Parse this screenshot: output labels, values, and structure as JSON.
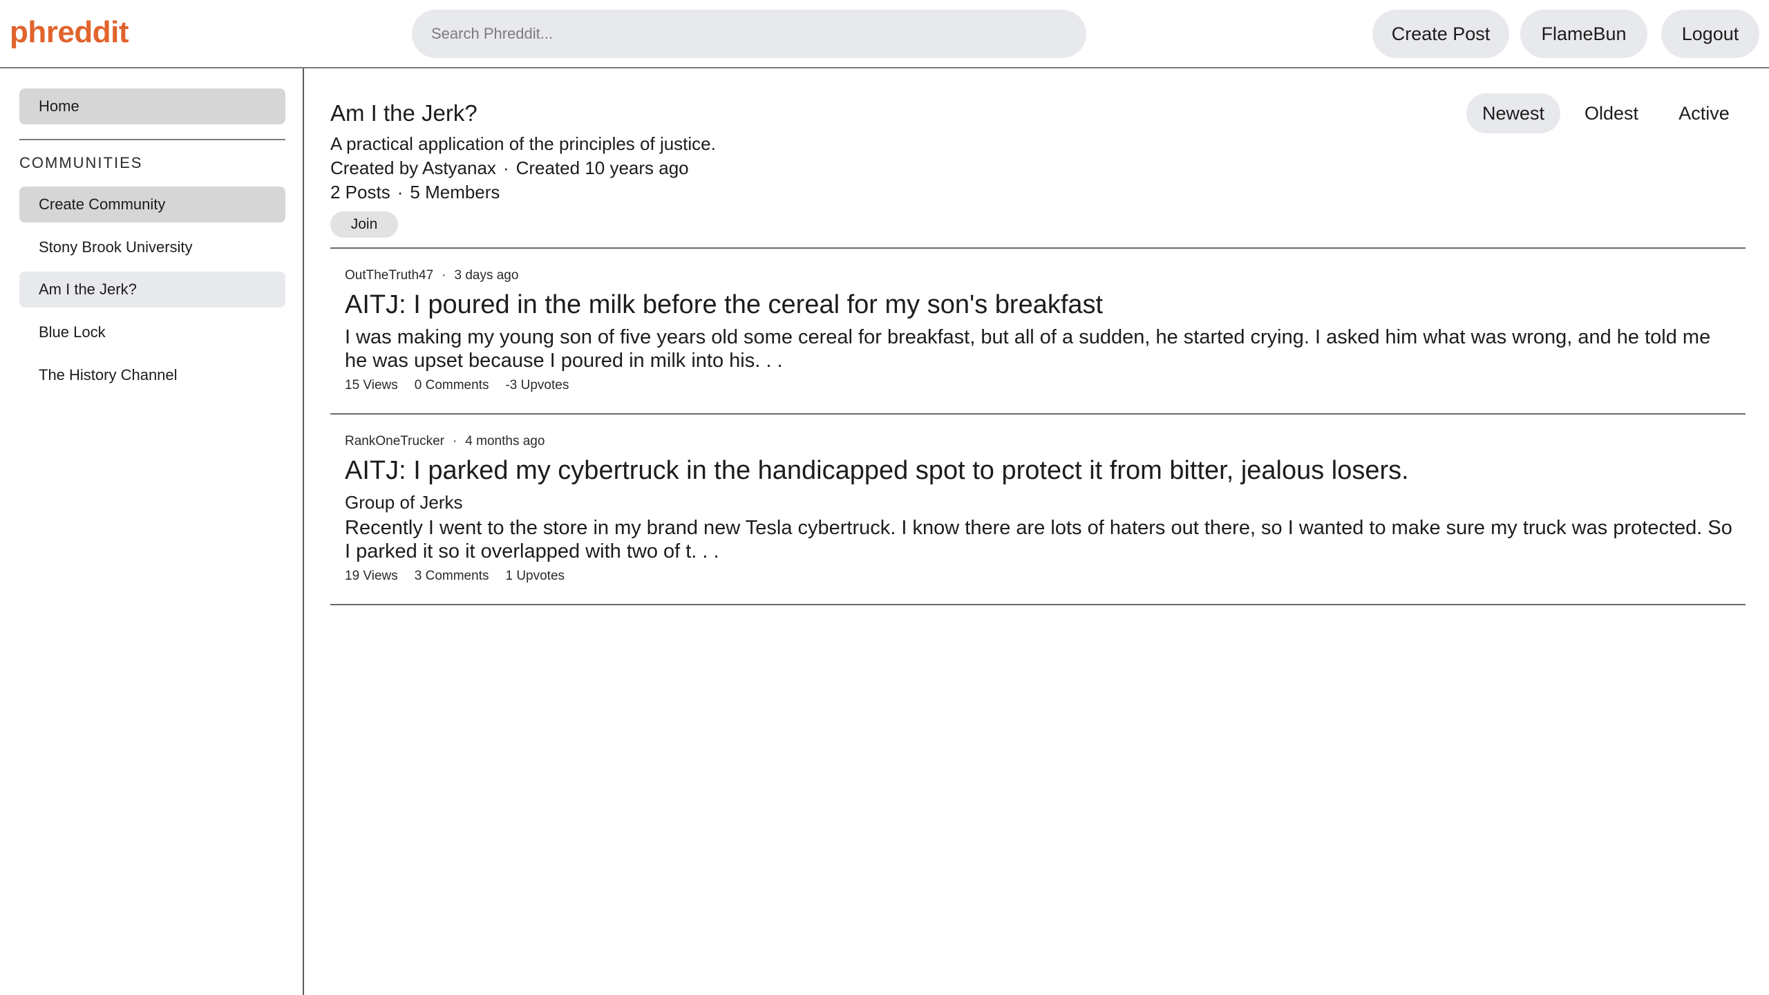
{
  "header": {
    "logo": "phreddit",
    "search_placeholder": "Search Phreddit...",
    "create_post": "Create Post",
    "username": "FlameBun",
    "logout": "Logout"
  },
  "sidebar": {
    "home": "Home",
    "communities_heading": "COMMUNITIES",
    "create_community": "Create Community",
    "communities": [
      "Stony Brook University",
      "Am I the Jerk?",
      "Blue Lock",
      "The History Channel"
    ]
  },
  "community": {
    "name": "Am I the Jerk?",
    "description": "A practical application of the principles of justice.",
    "created_by": "Created by Astyanax",
    "created_ago": "Created 10 years ago",
    "posts_count": "2 Posts",
    "members_count": "5 Members",
    "join": "Join"
  },
  "sort": {
    "newest": "Newest",
    "oldest": "Oldest",
    "active": "Active",
    "selected": "Newest"
  },
  "posts": [
    {
      "author": "OutTheTruth47",
      "time": "3 days ago",
      "title": "AITJ: I poured in the milk before the cereal for my son's breakfast",
      "flair": "",
      "body": "I was making my young son of five years old some cereal for breakfast, but all of a sudden, he started crying. I asked him what was wrong, and he told me he was upset because I poured in milk into his. . .",
      "views": "15 Views",
      "comments": "0 Comments",
      "upvotes": "-3 Upvotes"
    },
    {
      "author": "RankOneTrucker",
      "time": "4 months ago",
      "title": "AITJ: I parked my cybertruck in the handicapped spot to protect it from bitter, jealous losers.",
      "flair": "Group of Jerks",
      "body": "Recently I went to the store in my brand new Tesla cybertruck. I know there are lots of haters out there, so I wanted to make sure my truck was protected. So I parked it so it overlapped with two of t. . .",
      "views": "19 Views",
      "comments": "3 Comments",
      "upvotes": "1 Upvotes"
    }
  ],
  "colors": {
    "brand": "#e0642c",
    "button_bg": "#e8e9ec",
    "sidebar_gray": "#d6d6d6"
  }
}
